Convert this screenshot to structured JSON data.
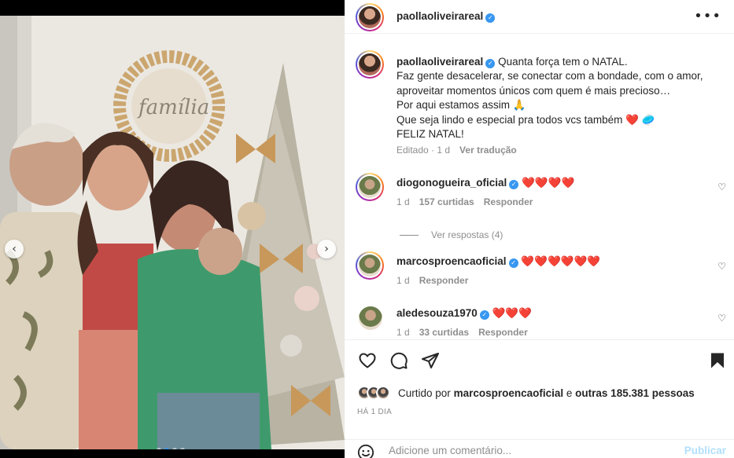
{
  "post": {
    "author": "paollaoliveirareal",
    "more_icon": "more-icon"
  },
  "caption": {
    "author": "paollaoliveirareal",
    "lines": [
      "Quanta força tem o NATAL.",
      "Faz gente desacelerar, se conectar com a bondade, com o amor,",
      "aproveitar momentos únicos com quem é mais precioso…",
      "Por aqui estamos assim 🙏",
      "Que seja lindo e especial pra todos vcs também ❤️ 🥏",
      "FELIZ NATAL!"
    ],
    "edited": "Editado · 1 d",
    "translate": "Ver tradução"
  },
  "comments": [
    {
      "user": "diogonogueira_oficial",
      "text": "❤️❤️❤️❤️",
      "age": "1 d",
      "likes": "157 curtidas",
      "reply": "Responder"
    },
    {
      "user": "marcosproencaoficial",
      "text": "❤️❤️❤️❤️❤️❤️",
      "age": "1 d",
      "likes": "",
      "reply": "Responder"
    },
    {
      "user": "aledesouza1970",
      "text": "❤️❤️❤️",
      "age": "1 d",
      "likes": "33 curtidas",
      "reply": "Responder"
    }
  ],
  "view_replies": "Ver respostas (4)",
  "likes": {
    "prefix": "Curtido por",
    "user": "marcosproencaoficial",
    "middle": "e",
    "others": "outras 185.381 pessoas"
  },
  "time_ago": "HÁ 1 DIA",
  "composer": {
    "placeholder": "Adicione um comentário...",
    "publish": "Publicar"
  },
  "carousel": {
    "slides": 4,
    "active": 1
  },
  "colors": {
    "accent": "#3897f0",
    "heart": "#e0102b",
    "publish_disabled": "#b2dffc"
  }
}
